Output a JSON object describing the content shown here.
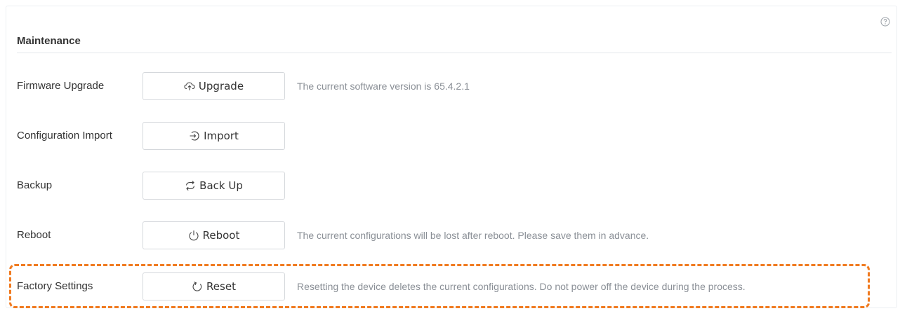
{
  "section": {
    "title": "Maintenance"
  },
  "rows": [
    {
      "label": "Firmware Upgrade",
      "button_label": "Upgrade",
      "button_icon": "cloud-upload-icon",
      "note": "The current software version is 65.4.2.1"
    },
    {
      "label": "Configuration Import",
      "button_label": "Import",
      "button_icon": "import-icon",
      "note": ""
    },
    {
      "label": "Backup",
      "button_label": "Back Up",
      "button_icon": "sync-icon",
      "note": ""
    },
    {
      "label": "Reboot",
      "button_label": "Reboot",
      "button_icon": "power-icon",
      "note": "The current configurations will be lost after reboot. Please save them in advance."
    },
    {
      "label": "Factory Settings",
      "button_label": "Reset",
      "button_icon": "reset-icon",
      "note": "Resetting the device deletes the current configurations. Do not power off the device during the process."
    }
  ],
  "icons": {
    "help": "help-icon"
  },
  "colors": {
    "highlight": "#f07a1f",
    "note_text": "#8a8f96",
    "button_border": "#d5d8dc"
  }
}
